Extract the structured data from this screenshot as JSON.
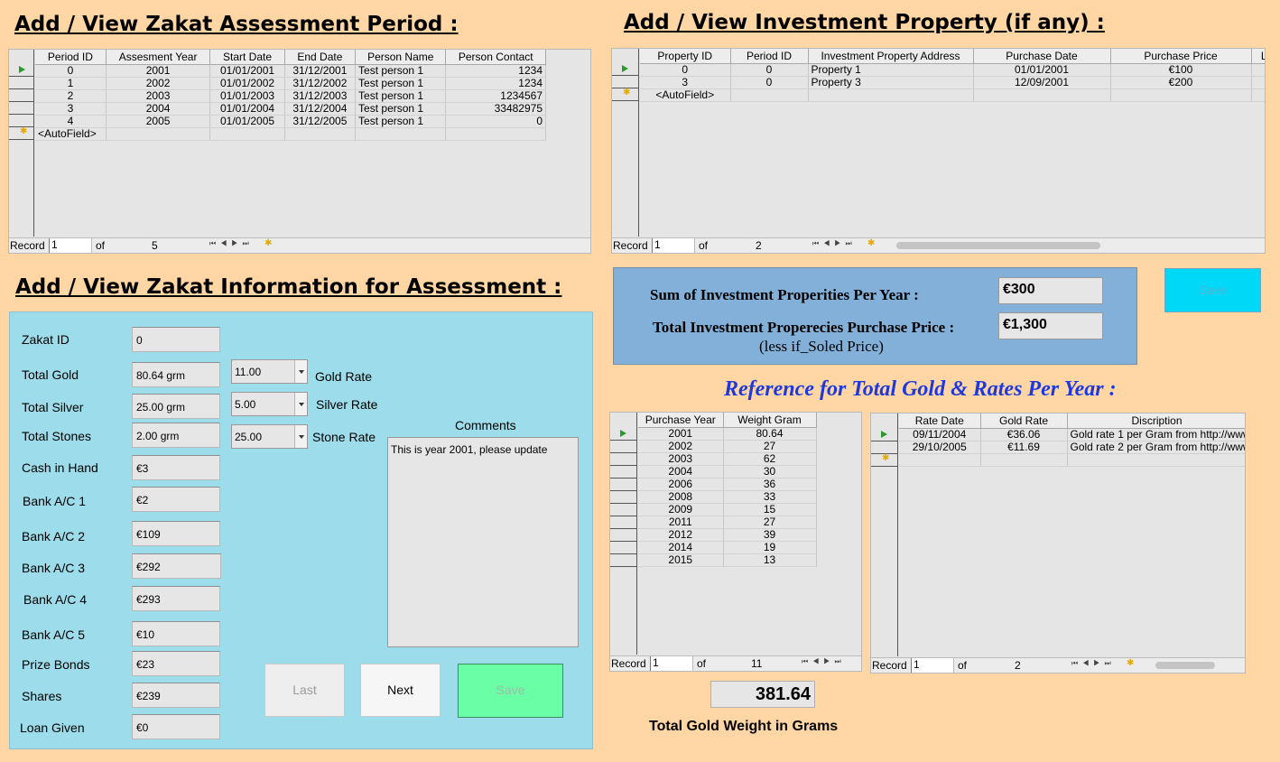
{
  "colors": {
    "background": "#ffd6a4",
    "panel": "#9ddcea",
    "sum_panel": "#82b0d8",
    "ref_title": "#1e38e0",
    "save_green": "#6affa6",
    "save_cyan": "#00d8f8"
  },
  "periods": {
    "title": "Add / View Zakat Assessment Period :",
    "columns": [
      "Period ID",
      "Assesment Year",
      "Start Date",
      "End Date",
      "Person Name",
      "Person Contact"
    ],
    "rows": [
      [
        "0",
        "2001",
        "01/01/2001",
        "31/12/2001",
        "Test person 1",
        "1234"
      ],
      [
        "1",
        "2002",
        "01/01/2002",
        "31/12/2002",
        "Test person 1",
        "1234"
      ],
      [
        "2",
        "2003",
        "01/01/2003",
        "31/12/2003",
        "Test person 1",
        "1234567"
      ],
      [
        "3",
        "2004",
        "01/01/2004",
        "31/12/2004",
        "Test person 1",
        "33482975"
      ],
      [
        "4",
        "2005",
        "01/01/2005",
        "31/12/2005",
        "Test person 1",
        "0"
      ]
    ],
    "new_row": "<AutoField>",
    "record_label": "Record",
    "record_value": "1",
    "of_label": "of",
    "total": "5"
  },
  "investment": {
    "title": "Add / View Investment Property (if any) :",
    "columns": [
      "Property ID",
      "Period ID",
      "Investment Property Address",
      "Purchase Date",
      "Purchase Price",
      "Lo"
    ],
    "rows": [
      [
        "0",
        "0",
        "Property 1",
        "01/01/2001",
        "€100",
        ""
      ],
      [
        "3",
        "0",
        "Property 3",
        "12/09/2001",
        "€200",
        ""
      ]
    ],
    "new_row": "<AutoField>",
    "record_label": "Record",
    "record_value": "1",
    "of_label": "of",
    "total": "2"
  },
  "summary": {
    "sum_label": "Sum of Investment Properities Per Year :",
    "sum_value": "€300",
    "total_label": "Total Investment Properecies Purchase Price :",
    "total_value": "€1,300",
    "total_note": "(less if_Soled Price)",
    "save_label": "Save"
  },
  "zakat": {
    "title": "Add / View Zakat Information for Assessment :",
    "fields": [
      {
        "label": "Zakat ID",
        "value": "0"
      },
      {
        "label": "Total Gold",
        "value": "80.64 grm"
      },
      {
        "label": "Total Silver",
        "value": "25.00 grm"
      },
      {
        "label": "Total Stones",
        "value": "2.00 grm"
      },
      {
        "label": "Cash in Hand",
        "value": "€3"
      },
      {
        "label": "Bank A/C 1",
        "value": "€2"
      },
      {
        "label": "Bank A/C 2",
        "value": "€109"
      },
      {
        "label": "Bank A/C 3",
        "value": "€292"
      },
      {
        "label": "Bank A/C 4",
        "value": "€293"
      },
      {
        "label": "Bank A/C 5",
        "value": "€10"
      },
      {
        "label": "Prize Bonds",
        "value": "€23"
      },
      {
        "label": "Shares",
        "value": "€239"
      },
      {
        "label": "Loan Given",
        "value": "€0"
      }
    ],
    "rates": [
      {
        "value": "11.00",
        "label": "Gold Rate"
      },
      {
        "value": "5.00",
        "label": "Silver Rate"
      },
      {
        "value": "25.00",
        "label": "Stone Rate"
      }
    ],
    "comments_label": "Comments",
    "comments_value": "This is year 2001, please update",
    "last_label": "Last",
    "next_label": "Next",
    "save_label": "Save"
  },
  "reference": {
    "title": "Reference for Total Gold & Rates Per Year :",
    "gold": {
      "columns": [
        "Purchase Year",
        "Weight Gram"
      ],
      "rows": [
        [
          "2001",
          "80.64"
        ],
        [
          "2002",
          "27"
        ],
        [
          "2003",
          "62"
        ],
        [
          "2004",
          "30"
        ],
        [
          "2006",
          "36"
        ],
        [
          "2008",
          "33"
        ],
        [
          "2009",
          "15"
        ],
        [
          "2011",
          "27"
        ],
        [
          "2012",
          "39"
        ],
        [
          "2014",
          "19"
        ],
        [
          "2015",
          "13"
        ]
      ],
      "record_label": "Record",
      "record_value": "1",
      "of_label": "of",
      "total": "11"
    },
    "rates": {
      "columns": [
        "Rate Date",
        "Gold Rate",
        "Discription"
      ],
      "rows": [
        [
          "09/11/2004",
          "€36.06",
          "Gold rate 1 per Gram from http://www"
        ],
        [
          "29/10/2005",
          "€11.69",
          "Gold rate 2 per Gram from http://www"
        ]
      ],
      "record_label": "Record",
      "record_value": "1",
      "of_label": "of",
      "total": "2"
    },
    "total_weight": "381.64",
    "total_weight_label": "Total Gold Weight in Grams"
  }
}
